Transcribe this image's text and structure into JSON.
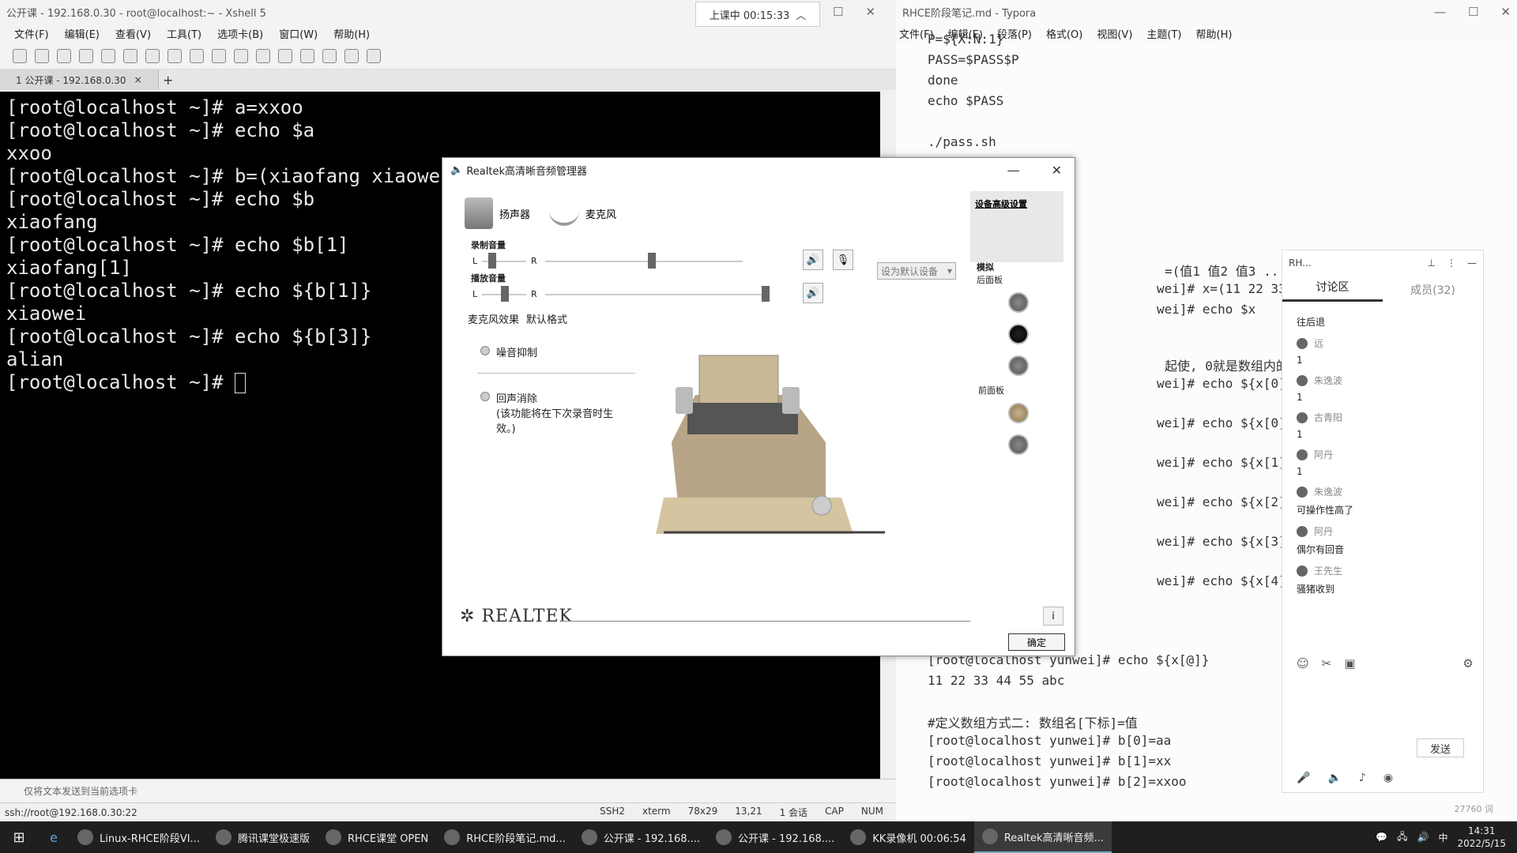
{
  "xshell": {
    "title": "公开课 - 192.168.0.30 - root@localhost:~ - Xshell 5",
    "timer": "上课中 00:15:33",
    "menu": [
      "文件(F)",
      "编辑(E)",
      "查看(V)",
      "工具(T)",
      "选项卡(B)",
      "窗口(W)",
      "帮助(H)"
    ],
    "tab_label": "1 公开课 - 192.168.0.30",
    "terminal_lines": [
      "[root@localhost ~]# a=xxoo",
      "[root@localhost ~]# echo $a",
      "xxoo",
      "[root@localhost ~]# b=(xiaofang xiaowei",
      "[root@localhost ~]# echo $b",
      "xiaofang",
      "[root@localhost ~]# echo $b[1]",
      "xiaofang[1]",
      "[root@localhost ~]# echo ${b[1]}",
      "xiaowei",
      "[root@localhost ~]# echo ${b[3]}",
      "alian",
      "[root@localhost ~]# "
    ],
    "send_hint": "仅将文本发送到当前选项卡",
    "status_left": "ssh://root@192.168.0.30:22",
    "status_right": [
      "SSH2",
      "xterm",
      "78x29",
      "13,21",
      "1 会话",
      "CAP",
      "NUM"
    ]
  },
  "typora": {
    "title": "RHCE阶段笔记.md - Typora",
    "menu": [
      "文件(F)",
      "编辑(E)",
      "段落(P)",
      "格式(O)",
      "视图(V)",
      "主题(T)",
      "帮助(H)"
    ],
    "lines_top": [
      "P=${X:N:1}",
      "PASS=$PASS$P",
      "done",
      "echo $PASS",
      "./pass.sh"
    ],
    "lines_mid": [
      "=(值1 值2 值3 .. .. 值n)",
      "wei]# x=(11 22 33 44 55 abc",
      "wei]# echo $x",
      "起使, 0就是数组内的第一个值",
      "wei]# echo ${x[0]}",
      "wei]# echo ${x[0]}",
      "wei]# echo ${x[1]}",
      "wei]# echo ${x[2]}",
      "wei]# echo ${x[3]}",
      "wei]# echo ${x[4]}"
    ],
    "lines_bottom": [
      "[root@localhost yunwei]# echo ${x[@]}",
      "11 22 33 44 55 abc",
      "#定义数组方式二: 数组名[下标]=值",
      "[root@localhost yunwei]# b[0]=aa",
      "[root@localhost yunwei]# b[1]=xx",
      "[root@localhost yunwei]# b[2]=xxoo"
    ],
    "word_count": "27760 词"
  },
  "discussion": {
    "header": "RH...",
    "tab_active": "讨论区",
    "tab_members": "成员(32)",
    "messages": [
      {
        "name": "",
        "text": "往后退"
      },
      {
        "name": "远",
        "text": "1"
      },
      {
        "name": "朱逸波",
        "text": "1"
      },
      {
        "name": "古青阳",
        "text": "1"
      },
      {
        "name": "阿丹",
        "text": "1"
      },
      {
        "name": "朱逸波",
        "text": "可操作性高了"
      },
      {
        "name": "阿丹",
        "text": "偶尔有回音"
      },
      {
        "name": "王先生",
        "text": "骚猪收到"
      }
    ],
    "send_label": "发送"
  },
  "realtek": {
    "title": "Realtek高清晰音频管理器",
    "tab_speaker": "扬声器",
    "tab_mic": "麦克风",
    "record_volume": "录制音量",
    "playback_volume": "播放音量",
    "left": "L",
    "right": "R",
    "mic_effects": "麦克风效果",
    "default_format": "默认格式",
    "set_default": "设为默认设备",
    "noise_suppression": "噪音抑制",
    "echo_cancel": "回声消除",
    "echo_note": "(该功能将在下次录音时生效。)",
    "advanced": "设备高级设置",
    "analog": "模拟",
    "back_panel": "后面板",
    "front_panel": "前面板",
    "brand": "REALTEK",
    "ok": "确定"
  },
  "taskbar": {
    "tasks": [
      "Linux-RHCE阶段VI...",
      "腾讯课堂极速版",
      "RHCE课堂 OPEN",
      "RHCE阶段笔记.md...",
      "公开课 - 192.168....",
      "公开课 - 192.168....",
      "KK录像机 00:06:54",
      "Realtek高清晰音频..."
    ],
    "ime": "中",
    "time": "14:31",
    "date": "2022/5/15"
  }
}
